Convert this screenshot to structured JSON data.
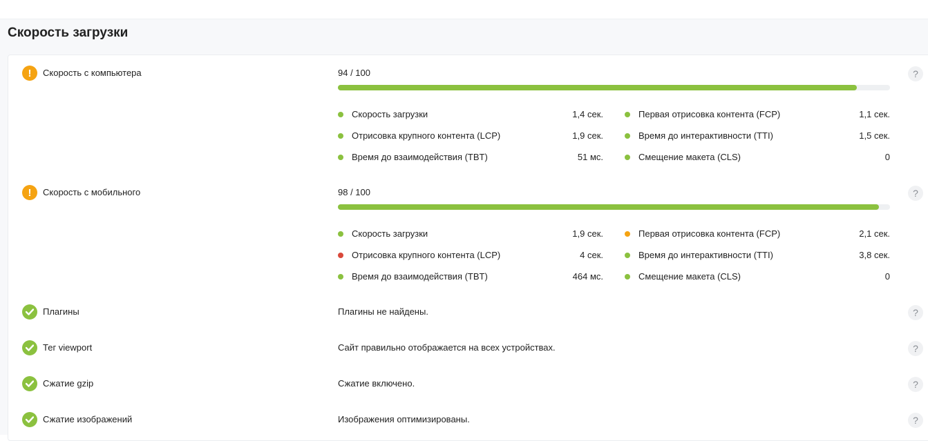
{
  "title": "Скорость загрузки",
  "colors": {
    "good": "#8bc13f",
    "warn": "#f5a312",
    "bad": "#d9493b"
  },
  "speed_rows": [
    {
      "label": "Скорость с компьютера",
      "status": "warn",
      "status_icon": "!",
      "score_text": "94 / 100",
      "score": 94,
      "metrics": [
        {
          "label": "Скорость загрузки",
          "value": "1,4 сек.",
          "status": "good"
        },
        {
          "label": "Первая отрисовка контента (FCP)",
          "value": "1,1 сек.",
          "status": "good"
        },
        {
          "label": "Отрисовка крупного контента (LCP)",
          "value": "1,9 сек.",
          "status": "good"
        },
        {
          "label": "Время до интерактивности (TTI)",
          "value": "1,5 сек.",
          "status": "good"
        },
        {
          "label": "Время до взаимодействия (TBT)",
          "value": "51 мс.",
          "status": "good"
        },
        {
          "label": "Смещение макета (CLS)",
          "value": "0",
          "status": "good"
        }
      ]
    },
    {
      "label": "Скорость с мобильного",
      "status": "warn",
      "status_icon": "!",
      "score_text": "98 / 100",
      "score": 98,
      "metrics": [
        {
          "label": "Скорость загрузки",
          "value": "1,9 сек.",
          "status": "good"
        },
        {
          "label": "Первая отрисовка контента (FCP)",
          "value": "2,1 сек.",
          "status": "warn"
        },
        {
          "label": "Отрисовка крупного контента (LCP)",
          "value": "4 сек.",
          "status": "bad"
        },
        {
          "label": "Время до интерактивности (TTI)",
          "value": "3,8 сек.",
          "status": "good"
        },
        {
          "label": "Время до взаимодействия (TBT)",
          "value": "464 мс.",
          "status": "good"
        },
        {
          "label": "Смещение макета (CLS)",
          "value": "0",
          "status": "good"
        }
      ]
    }
  ],
  "check_rows": [
    {
      "label": "Плагины",
      "description": "Плагины не найдены.",
      "status": "ok"
    },
    {
      "label": "Тег viewport",
      "description": "Сайт правильно отображается на всех устройствах.",
      "status": "ok"
    },
    {
      "label": "Сжатие gzip",
      "description": "Сжатие включено.",
      "status": "ok"
    },
    {
      "label": "Сжатие изображений",
      "description": "Изображения оптимизированы.",
      "status": "ok"
    }
  ],
  "help_icon": "?",
  "check_icon": "check-icon"
}
